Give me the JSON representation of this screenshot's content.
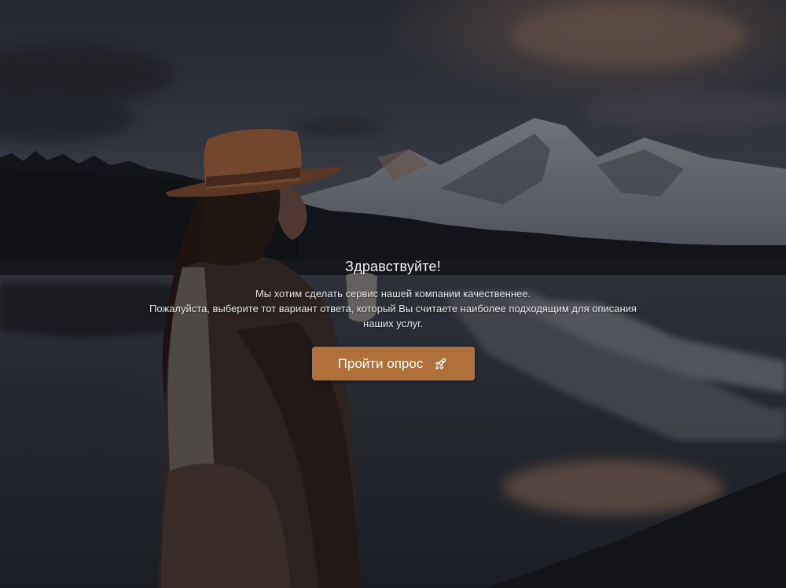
{
  "hero": {
    "greeting": "Здравствуйте!",
    "description_lines": [
      "Мы хотим сделать сервис нашей компании качественнее.",
      "Пожалуйста, выберите тот вариант ответа, который Вы считаете наиболее подходящим для описания",
      "наших услуг."
    ]
  },
  "cta": {
    "label": "Пройти опрос",
    "icon": "rocket-icon",
    "color": "#b0703a"
  },
  "colors": {
    "hat": "#a0603a",
    "text": "#ffffff"
  }
}
